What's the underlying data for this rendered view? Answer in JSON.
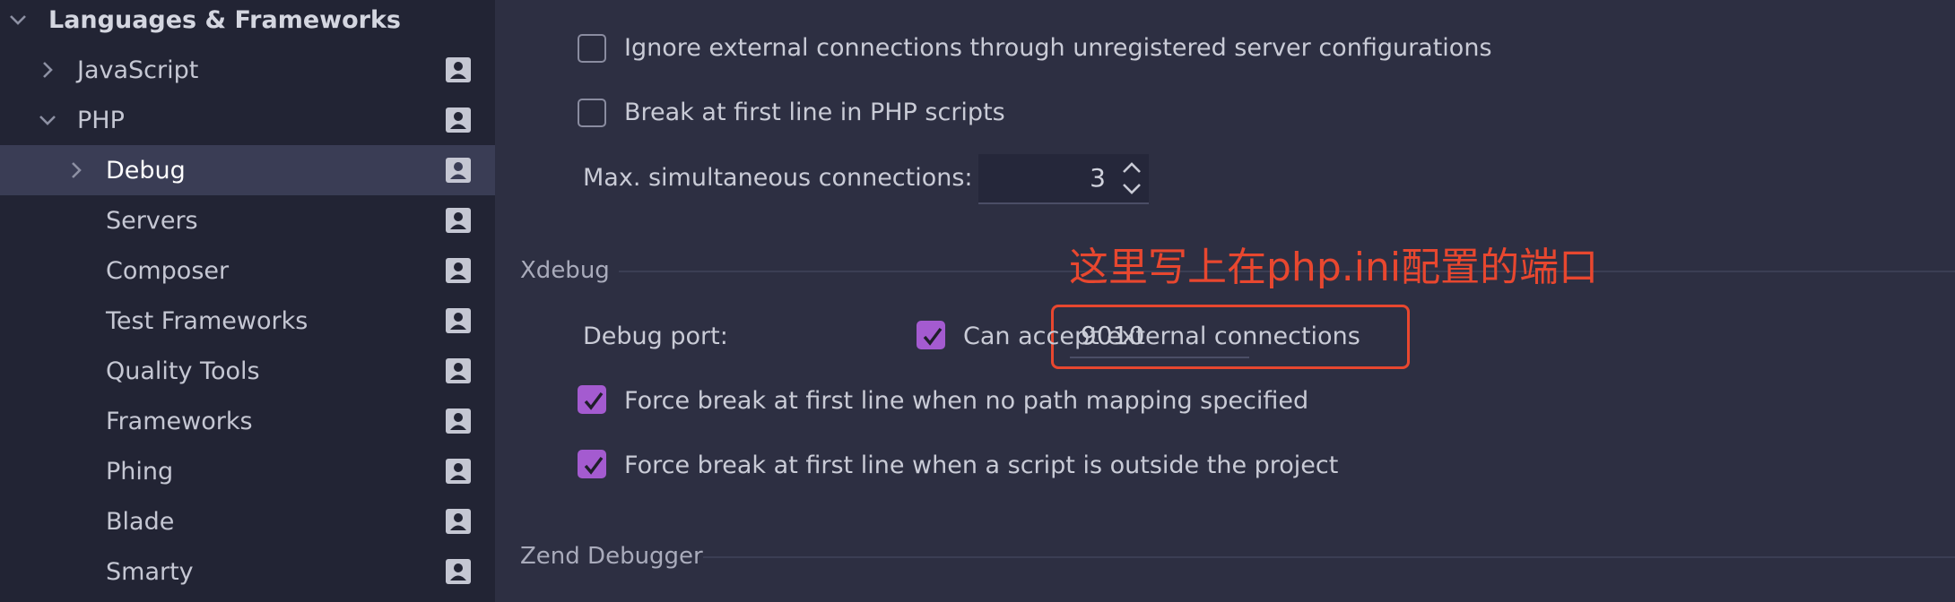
{
  "sidebar": {
    "items": [
      {
        "label": "Languages & Frameworks",
        "expanded": true,
        "has_chevron": true,
        "level": 0
      },
      {
        "label": "JavaScript",
        "expanded": false,
        "has_chevron": true,
        "level": 1
      },
      {
        "label": "PHP",
        "expanded": true,
        "has_chevron": true,
        "level": 1
      },
      {
        "label": "Debug",
        "expanded": false,
        "has_chevron": true,
        "level": 2,
        "selected": true
      },
      {
        "label": "Servers",
        "level": 2
      },
      {
        "label": "Composer",
        "level": 2
      },
      {
        "label": "Test Frameworks",
        "level": 2
      },
      {
        "label": "Quality Tools",
        "level": 2
      },
      {
        "label": "Frameworks",
        "level": 2
      },
      {
        "label": "Phing",
        "level": 2
      },
      {
        "label": "Blade",
        "level": 2
      },
      {
        "label": "Smarty",
        "level": 2
      }
    ],
    "row_icon": "project-settings-icon"
  },
  "options": {
    "ignore_external": {
      "label": "Ignore external connections through unregistered server configurations",
      "checked": false
    },
    "break_first_line": {
      "label": "Break at first line in PHP scripts",
      "checked": false
    },
    "max_connections": {
      "label": "Max. simultaneous connections:",
      "value": "3"
    }
  },
  "xdebug": {
    "title": "Xdebug",
    "debug_port_label": "Debug port:",
    "debug_port_value": "9010",
    "accept_external": {
      "label": "Can accept external connections",
      "checked": true
    },
    "force_break_no_mapping": {
      "label": "Force break at first line when no path mapping specified",
      "checked": true
    },
    "force_break_outside": {
      "label": "Force break at first line when a script is outside the project",
      "checked": true
    }
  },
  "zend": {
    "title": "Zend Debugger"
  },
  "annotation": {
    "text": "这里写上在php.ini配置的端口",
    "color": "#e8472f"
  },
  "colors": {
    "accent_checkbox": "#a45bd0",
    "sidebar_bg": "#222434",
    "panel_bg": "#2d2f42",
    "selected_row": "#3a3d55"
  }
}
